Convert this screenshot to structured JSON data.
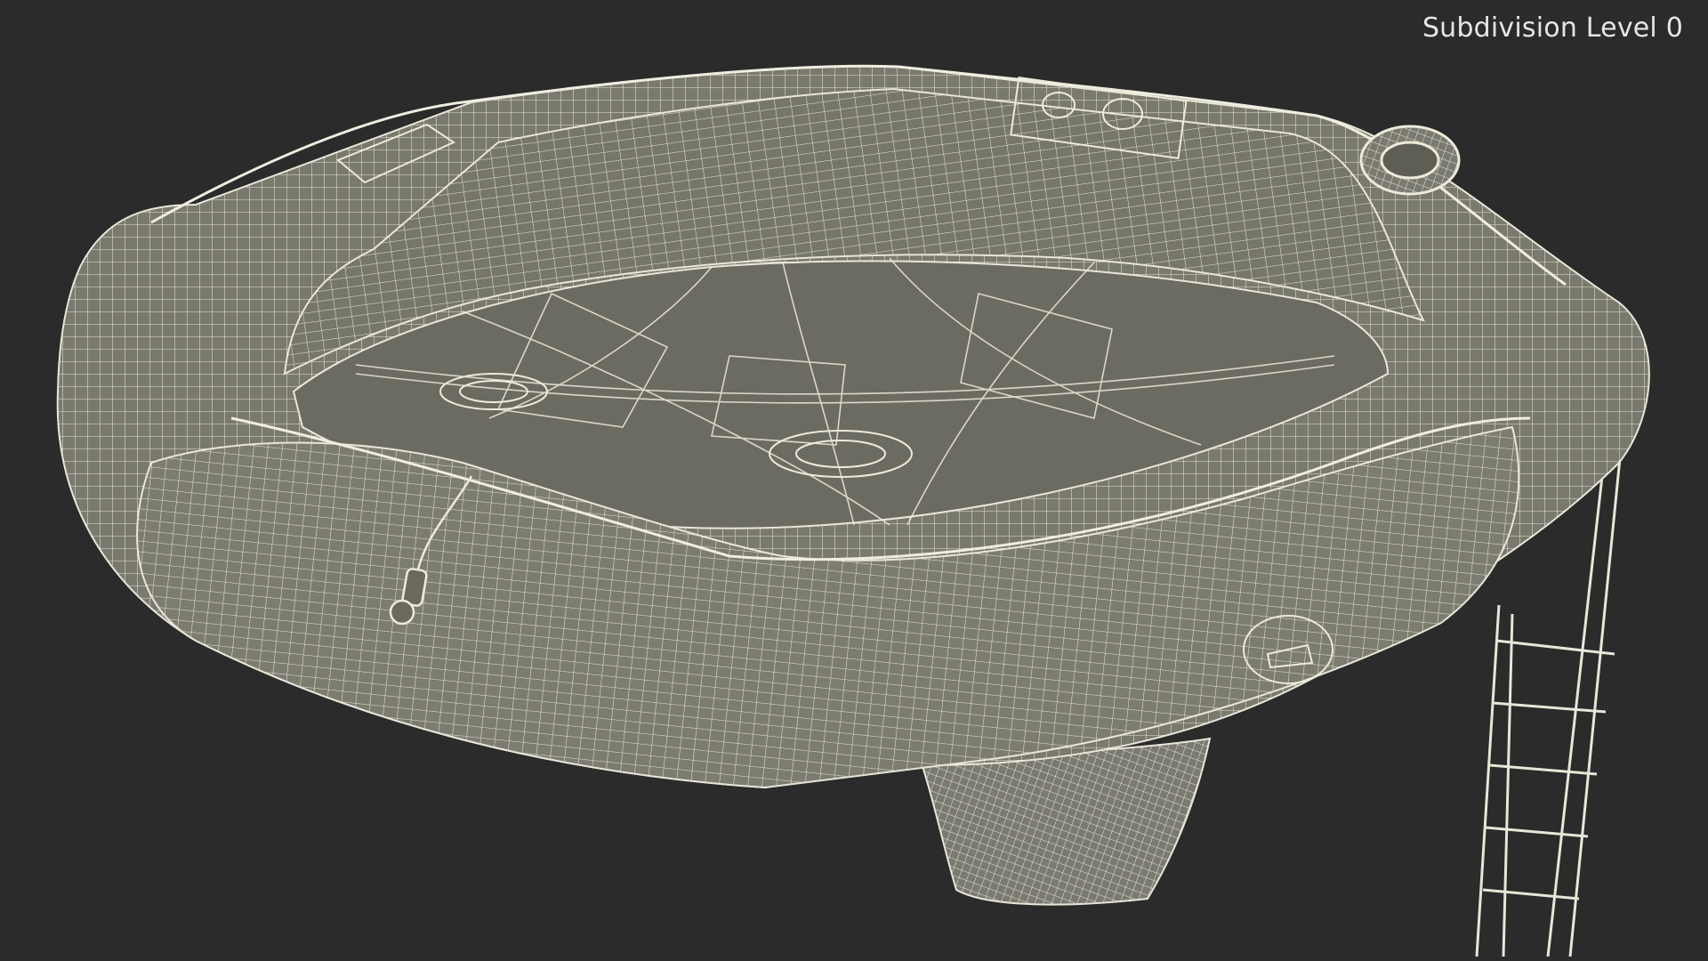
{
  "viewport": {
    "subdivision_label": "Subdivision Level 0",
    "background_color": "#2b2b2b"
  },
  "model": {
    "subject": "inflatable-life-raft-wireframe",
    "mesh_fill_color": "#7c7b70",
    "floor_fill_color": "#6a695f",
    "wire_color": "#e8e6d8"
  }
}
